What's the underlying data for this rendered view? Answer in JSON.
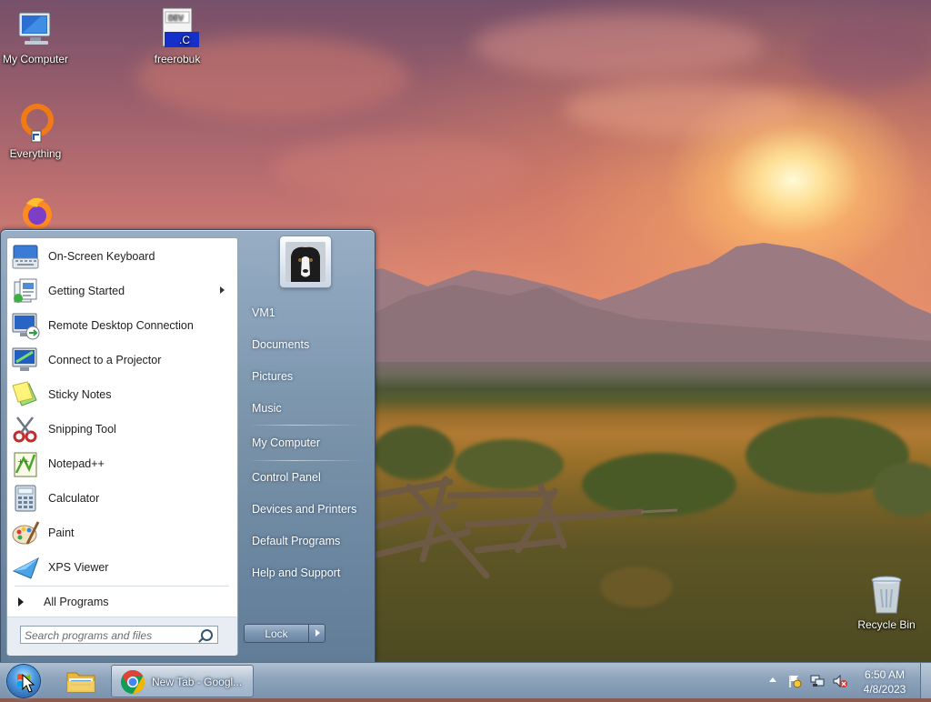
{
  "desktop": {
    "icons": [
      {
        "label": "My Computer"
      },
      {
        "label": "freerobuk"
      },
      {
        "label": "Everything"
      },
      {
        "label": "Recycle Bin"
      }
    ],
    "freerobuk_icon_text": "DEV",
    "freerobuk_ext": ".C"
  },
  "start_menu": {
    "programs": [
      {
        "label": "On-Screen Keyboard",
        "icon": "keyboard-icon"
      },
      {
        "label": "Getting Started",
        "icon": "getting-started-icon",
        "has_submenu": true
      },
      {
        "label": "Remote Desktop Connection",
        "icon": "remote-desktop-icon"
      },
      {
        "label": "Connect to a Projector",
        "icon": "projector-icon"
      },
      {
        "label": "Sticky Notes",
        "icon": "sticky-notes-icon"
      },
      {
        "label": "Snipping Tool",
        "icon": "scissors-icon"
      },
      {
        "label": "Notepad++",
        "icon": "notepad-plus-icon"
      },
      {
        "label": "Calculator",
        "icon": "calculator-icon"
      },
      {
        "label": "Paint",
        "icon": "paint-palette-icon"
      },
      {
        "label": "XPS Viewer",
        "icon": "xps-viewer-icon"
      }
    ],
    "all_programs": "All Programs",
    "search_placeholder": "Search programs and files",
    "right_items": {
      "user": "VM1",
      "documents": "Documents",
      "pictures": "Pictures",
      "music": "Music",
      "my_computer": "My Computer",
      "control_panel": "Control Panel",
      "devices_printers": "Devices and Printers",
      "default_programs": "Default Programs",
      "help_support": "Help and Support"
    },
    "lock_label": "Lock"
  },
  "taskbar": {
    "chrome_label": "New Tab - Googl...",
    "time": "6:50 AM",
    "date": "4/8/2023"
  },
  "colors": {
    "taskbar": "#8da3bb",
    "start_menu_right": "#7692ac",
    "chrome_red": "#db4437",
    "chrome_green": "#0f9d58",
    "chrome_yellow": "#f4b400",
    "chrome_blue": "#4285f4"
  }
}
